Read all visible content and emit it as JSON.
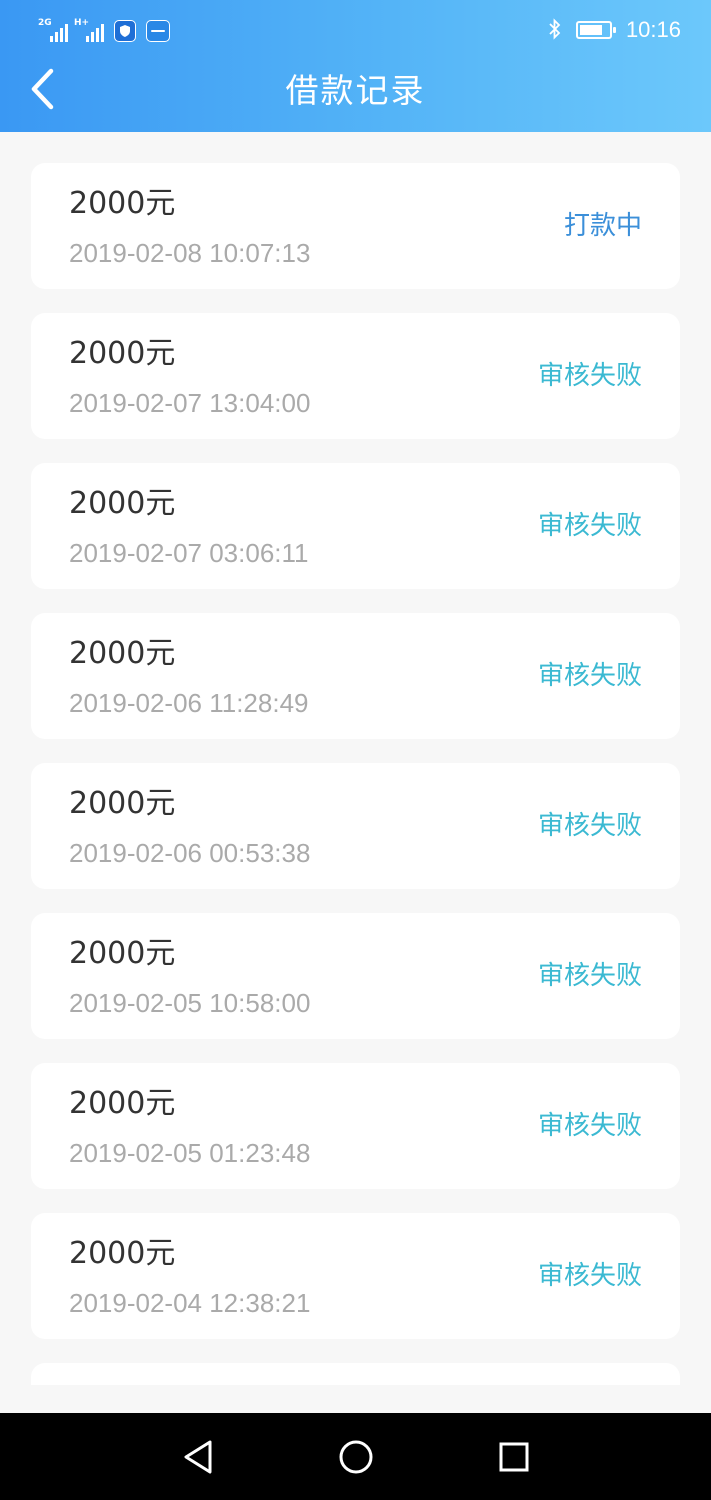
{
  "status_bar": {
    "signal1_tag": "2G",
    "signal2_tag": "H+",
    "time": "10:16",
    "battery_level": 0.8,
    "icons": [
      "signal-icon",
      "shield-app-icon",
      "app-icon",
      "bluetooth-icon",
      "battery-icon"
    ]
  },
  "header": {
    "title": "借款记录",
    "back_icon": "chevron-left-icon"
  },
  "records": [
    {
      "amount": "2000元",
      "time": "2019-02-08 10:07:13",
      "status": "打款中",
      "status_color": "#3b8fd9"
    },
    {
      "amount": "2000元",
      "time": "2019-02-07 13:04:00",
      "status": "审核失败",
      "status_color": "#3bb9d2"
    },
    {
      "amount": "2000元",
      "time": "2019-02-07 03:06:11",
      "status": "审核失败",
      "status_color": "#3bb9d2"
    },
    {
      "amount": "2000元",
      "time": "2019-02-06 11:28:49",
      "status": "审核失败",
      "status_color": "#3bb9d2"
    },
    {
      "amount": "2000元",
      "time": "2019-02-06 00:53:38",
      "status": "审核失败",
      "status_color": "#3bb9d2"
    },
    {
      "amount": "2000元",
      "time": "2019-02-05 10:58:00",
      "status": "审核失败",
      "status_color": "#3bb9d2"
    },
    {
      "amount": "2000元",
      "time": "2019-02-05 01:23:48",
      "status": "审核失败",
      "status_color": "#3bb9d2"
    },
    {
      "amount": "2000元",
      "time": "2019-02-04 12:38:21",
      "status": "审核失败",
      "status_color": "#3bb9d2"
    },
    {
      "amount": "",
      "time": "",
      "status": "",
      "status_color": "#3bb9d2"
    }
  ],
  "nav_bar": {
    "icons": [
      "back-triangle-icon",
      "home-circle-icon",
      "recents-square-icon"
    ]
  },
  "colors": {
    "header_gradient_start": "#3a98f3",
    "header_gradient_end": "#6cc8fb",
    "background": "#f7f7f7",
    "card": "#ffffff"
  }
}
